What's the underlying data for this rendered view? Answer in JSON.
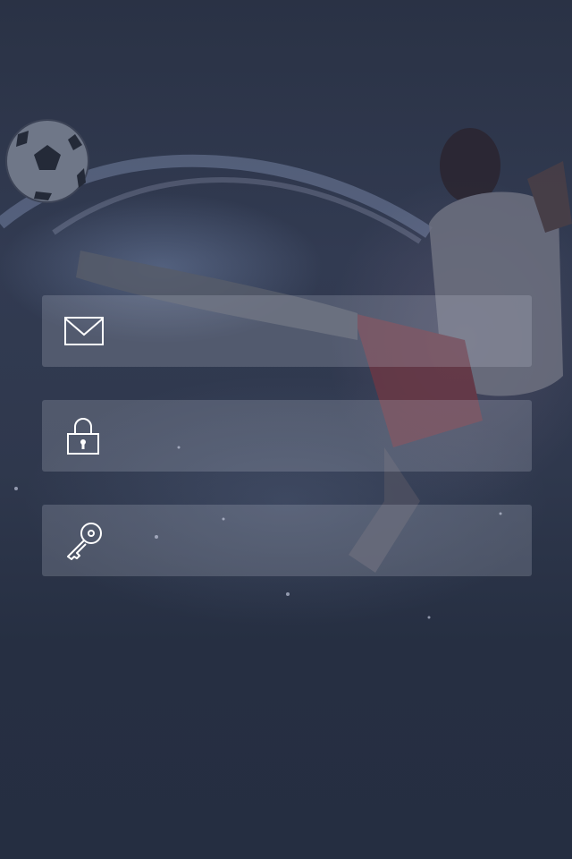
{
  "screen": {
    "background_image": "soccer-player-bicycle-kick",
    "overlay_color": "#262f42"
  },
  "form": {
    "email": {
      "icon": "envelope-icon",
      "value": "",
      "placeholder": ""
    },
    "password": {
      "icon": "lock-icon",
      "value": "",
      "placeholder": ""
    },
    "key": {
      "icon": "key-icon",
      "value": "",
      "placeholder": ""
    }
  }
}
